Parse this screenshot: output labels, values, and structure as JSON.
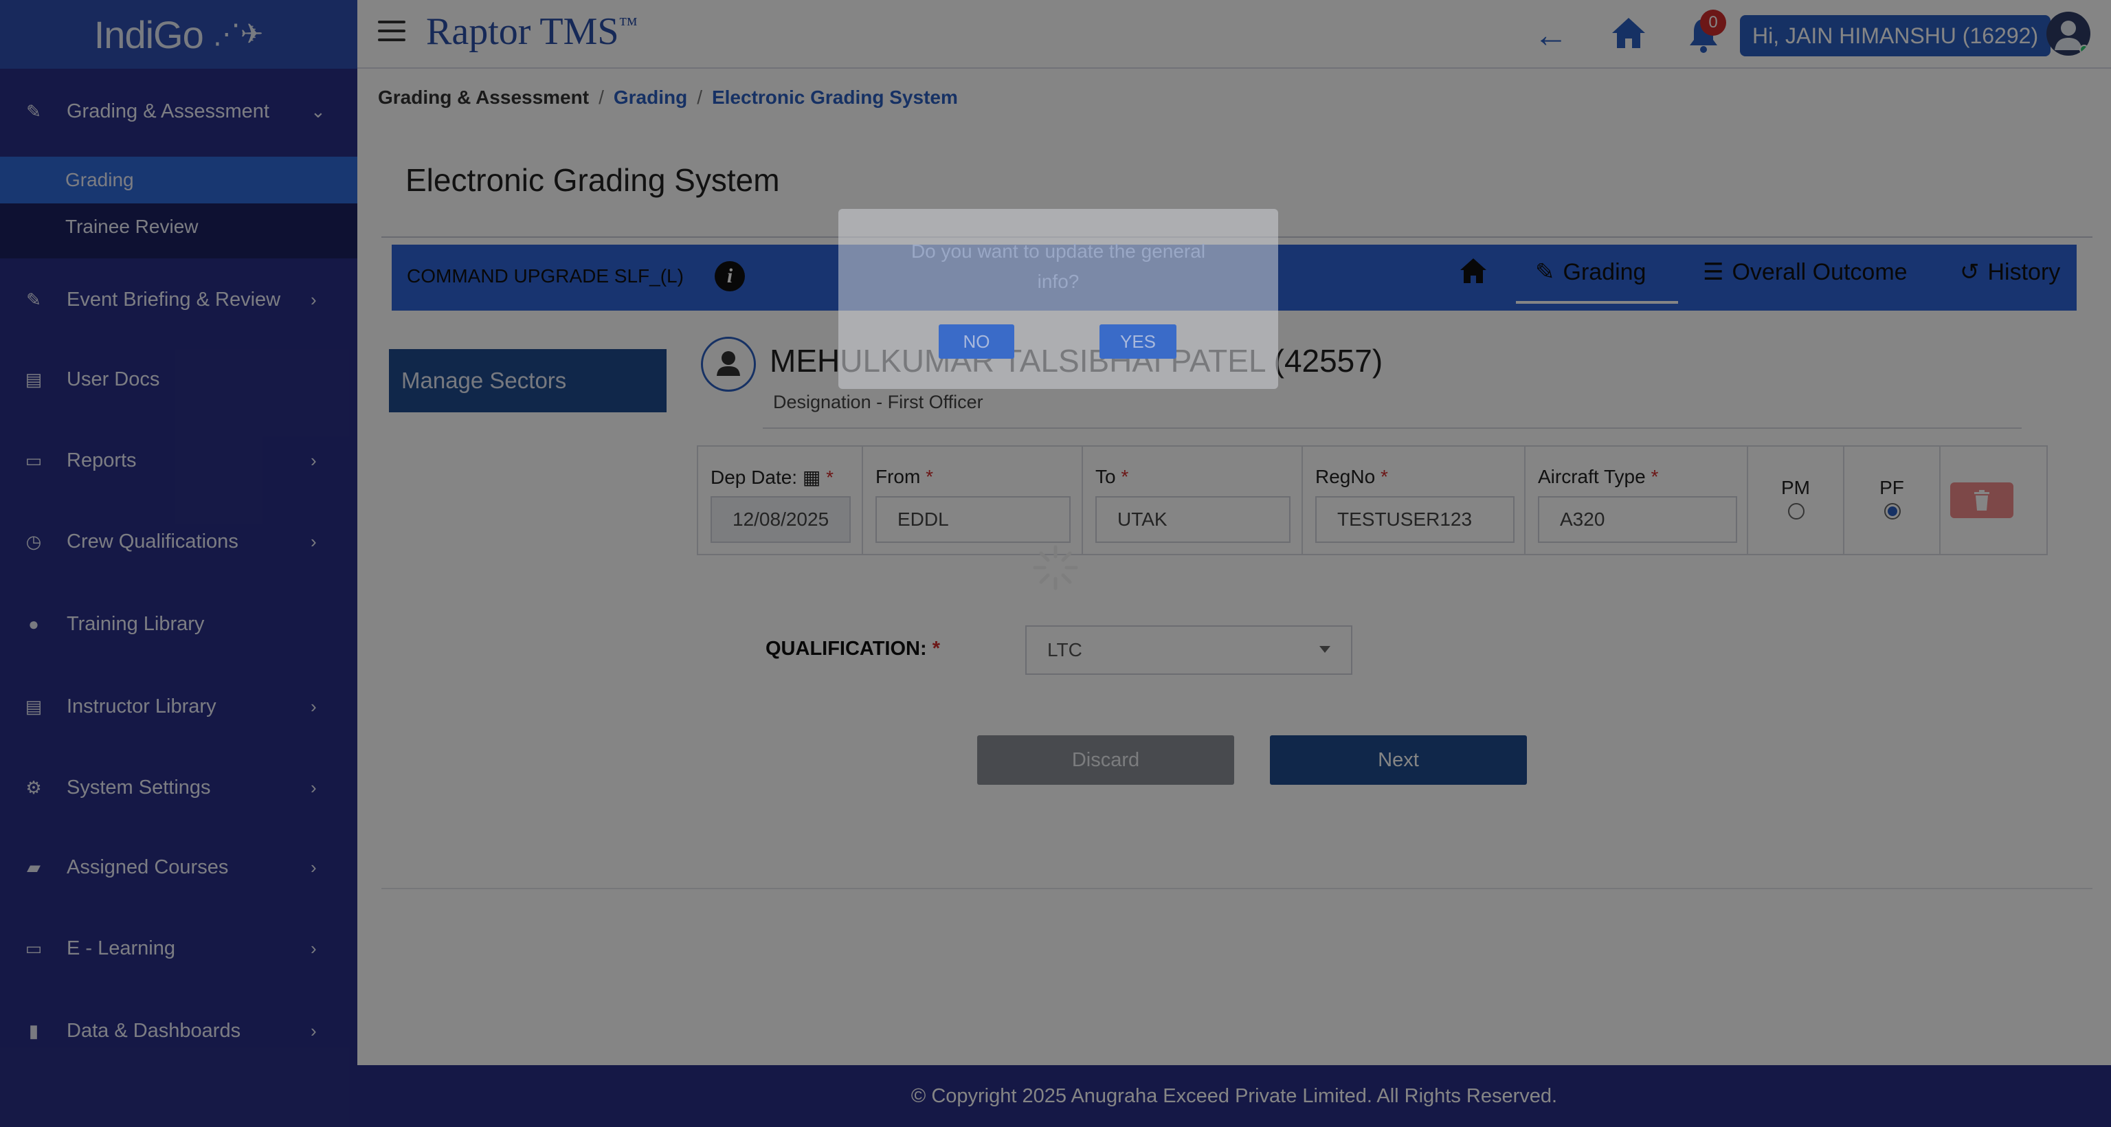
{
  "brand": {
    "logo": "IndiGo",
    "app_name": "Raptor TMS",
    "trademark": "™"
  },
  "header": {
    "notifications_count": "0",
    "user_greeting": "Hi, JAIN HIMANSHU (16292)"
  },
  "sidebar": {
    "items": [
      {
        "label": "Grading & Assessment",
        "icon": "edit-icon",
        "expanded": true,
        "sub": [
          {
            "label": "Grading",
            "active": true
          },
          {
            "label": "Trainee Review"
          }
        ]
      },
      {
        "label": "Event Briefing & Review",
        "icon": "edit-icon"
      },
      {
        "label": "User Docs",
        "icon": "document-icon"
      },
      {
        "label": "Reports",
        "icon": "report-icon"
      },
      {
        "label": "Crew Qualifications",
        "icon": "clock-icon"
      },
      {
        "label": "Training Library",
        "icon": "person-icon"
      },
      {
        "label": "Instructor Library",
        "icon": "document-icon"
      },
      {
        "label": "System Settings",
        "icon": "gears-icon"
      },
      {
        "label": "Assigned Courses",
        "icon": "folder-icon"
      },
      {
        "label": "E - Learning",
        "icon": "monitor-icon"
      },
      {
        "label": "Data & Dashboards",
        "icon": "file-icon"
      }
    ]
  },
  "breadcrumb": [
    "Grading & Assessment",
    "Grading",
    "Electronic Grading System"
  ],
  "page_title": "Electronic Grading System",
  "course_bar": {
    "course_name": "COMMAND UPGRADE SLF_(L)",
    "tabs": [
      "Grading",
      "Overall Outcome",
      "History"
    ],
    "active_tab": "Grading"
  },
  "manage_sectors_label": "Manage Sectors",
  "trainee": {
    "name": "MEHULKUMAR TALSIBHAI PATEL (42557)",
    "designation": "Designation - First Officer"
  },
  "sector": {
    "dep_date_label": "Dep Date:",
    "dep_date": "12/08/2025",
    "from_label": "From",
    "from": "EDDL",
    "to_label": "To",
    "to": "UTAK",
    "regno_label": "RegNo",
    "regno": "TESTUSER123",
    "aircraft_label": "Aircraft Type",
    "aircraft": "A320",
    "pm_label": "PM",
    "pf_label": "PF",
    "selected_role": "PF"
  },
  "qualification": {
    "label": "QUALIFICATION:",
    "value": "LTC"
  },
  "buttons": {
    "discard": "Discard",
    "next": "Next"
  },
  "footer": "© Copyright 2025 Anugraha Exceed Private Limited.  All Rights Reserved.",
  "dialog": {
    "message": "Do you want to update the general info?",
    "no": "NO",
    "yes": "YES"
  },
  "colors": {
    "sidebar_bg": "#2a2f86",
    "accent_blue": "#2f64d6",
    "dark_blue": "#1f4c8f",
    "required_red": "#d02c2c"
  }
}
